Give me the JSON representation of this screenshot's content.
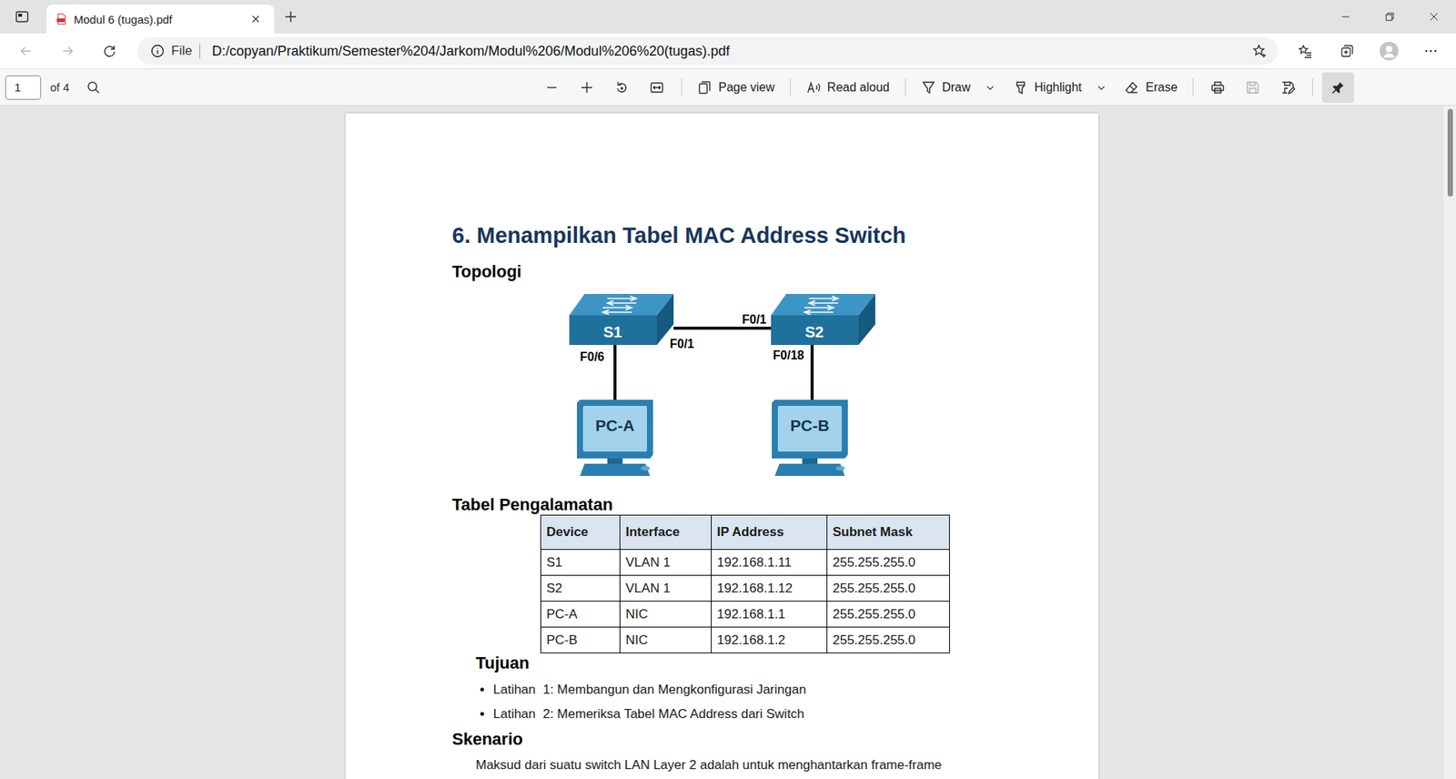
{
  "tabs": [
    {
      "label": "Modul 6 (tugas).pdf",
      "selected": true
    }
  ],
  "navigation": {
    "back_disabled": true,
    "forward_disabled": true
  },
  "address_bar": {
    "scheme": "File",
    "url": "D:/copyan/Praktikum/Semester%204/Jarkom/Modul%206/Modul%206%20(tugas).pdf"
  },
  "pdf_toolbar": {
    "page": "1",
    "page_total": "of 4",
    "tools": [
      {
        "label": "Page view",
        "dropdown": false
      },
      {
        "label": "Read aloud",
        "dropdown": false
      },
      {
        "label": "Draw",
        "dropdown": true
      },
      {
        "label": "Highlight",
        "dropdown": true
      },
      {
        "label": "Erase",
        "dropdown": false
      }
    ],
    "save_disabled": true,
    "pin_selected": true
  },
  "document": {
    "title": "6. Menampilkan Tabel MAC Address Switch",
    "topology": {
      "heading": "Topologi",
      "switches": [
        {
          "name": "S1"
        },
        {
          "name": "S2"
        }
      ],
      "pcs": [
        {
          "name": "PC-A"
        },
        {
          "name": "PC-B"
        }
      ],
      "ports": [
        {
          "label": "F0/6"
        },
        {
          "label": "F0/1"
        },
        {
          "label": "F0/1"
        },
        {
          "label": "F0/18"
        }
      ]
    },
    "table": {
      "heading": "Tabel Pengalamatan",
      "columns": [
        "Device",
        "Interface",
        "IP Address",
        "Subnet Mask"
      ],
      "rows": [
        [
          "S1",
          "VLAN 1",
          "192.168.1.11",
          "255.255.255.0"
        ],
        [
          "S2",
          "VLAN 1",
          "192.168.1.12",
          "255.255.255.0"
        ],
        [
          "PC-A",
          "NIC",
          "192.168.1.1",
          "255.255.255.0"
        ],
        [
          "PC-B",
          "NIC",
          "192.168.1.2",
          "255.255.255.0"
        ]
      ]
    },
    "objectives": {
      "heading": "Tujuan",
      "items": [
        "Latihan  1: Membangun dan Mengkonfigurasi Jaringan",
        "Latihan  2: Memeriksa Tabel MAC Address dari Switch"
      ]
    },
    "scenario": {
      "heading": "Skenario",
      "text": "Maksud dari suatu switch LAN Layer 2 adalah untuk menghantarkan frame-frame"
    }
  }
}
